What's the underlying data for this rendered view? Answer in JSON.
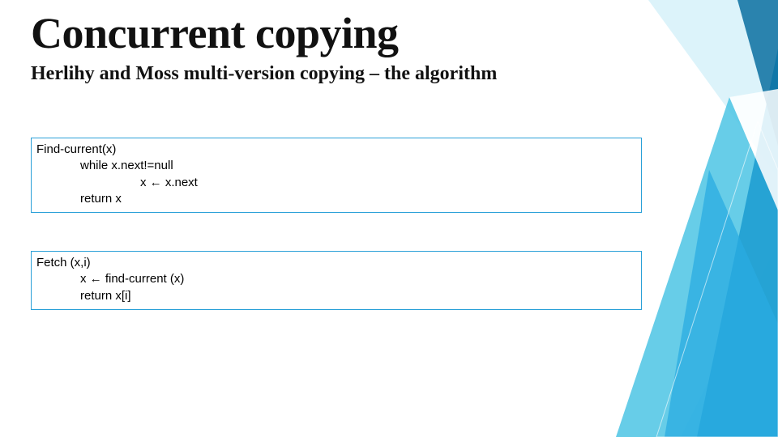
{
  "title": "Concurrent copying",
  "subtitle": "Herlihy and Moss multi-version copying – the algorithm",
  "code_block_1": {
    "line1": "Find-current(x)",
    "line2": "while x.next!=null",
    "line3": "x ← x.next",
    "line4": "return x"
  },
  "code_block_2": {
    "line1": "Fetch (x,i)",
    "line2": "x ← find-current (x)",
    "line3": "return x[i]"
  },
  "colors": {
    "box_border": "#2aa0d8",
    "accent_light": "#7fd6ec",
    "accent_mid": "#29abe2",
    "accent_dark": "#0a6ea0"
  }
}
